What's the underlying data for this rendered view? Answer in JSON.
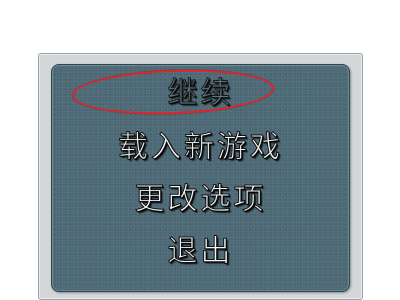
{
  "menu": {
    "items": [
      {
        "label": "继续",
        "enabled": false
      },
      {
        "label": "载入新游戏",
        "highlighted": true
      },
      {
        "label": "更改选项"
      },
      {
        "label": "退出"
      }
    ]
  },
  "colors": {
    "panel": "#4d6a76",
    "frame": "#d3d7d8",
    "text": "#f4f6f6",
    "highlight_ring": "#e0242a"
  }
}
